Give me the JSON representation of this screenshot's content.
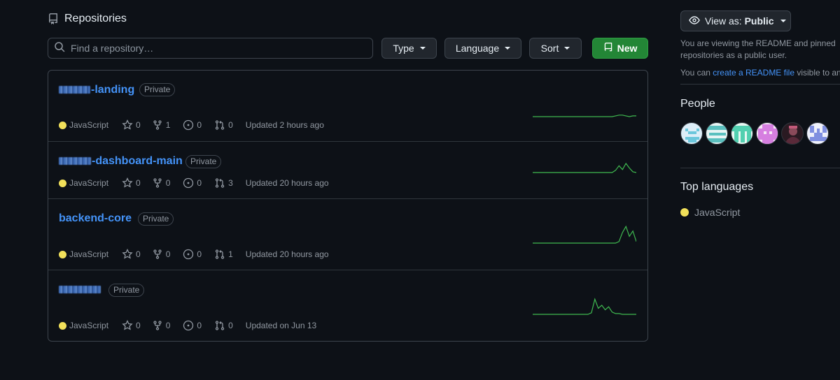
{
  "section": {
    "title": "Repositories"
  },
  "filters": {
    "search_placeholder": "Find a repository…",
    "type_label": "Type",
    "language_label": "Language",
    "sort_label": "Sort",
    "new_label": "New"
  },
  "repos": [
    {
      "name": "-landing",
      "visibility": "Private",
      "language": "JavaScript",
      "stars": "0",
      "forks": "1",
      "issues": "0",
      "prs": "0",
      "updated": "Updated 2 hours ago",
      "activity": [
        0,
        0,
        0,
        0,
        0,
        0,
        0,
        0,
        0,
        0,
        0,
        0,
        0,
        0,
        0,
        0,
        0,
        0,
        0,
        0,
        0,
        0,
        0,
        0,
        1,
        2,
        2,
        1,
        0,
        1,
        1
      ]
    },
    {
      "name": "-dashboard-main",
      "visibility": "Private",
      "language": "JavaScript",
      "stars": "0",
      "forks": "0",
      "issues": "0",
      "prs": "3",
      "updated": "Updated 20 hours ago",
      "activity": [
        0,
        0,
        0,
        0,
        0,
        0,
        0,
        0,
        0,
        0,
        0,
        0,
        0,
        0,
        0,
        0,
        0,
        0,
        0,
        0,
        0,
        0,
        0,
        0,
        3,
        9,
        4,
        12,
        6,
        1,
        0
      ]
    },
    {
      "name": "backend-core",
      "visibility": "Private",
      "language": "JavaScript",
      "stars": "0",
      "forks": "0",
      "issues": "0",
      "prs": "1",
      "updated": "Updated 20 hours ago",
      "activity": [
        0,
        0,
        0,
        0,
        0,
        0,
        0,
        0,
        0,
        0,
        0,
        0,
        0,
        0,
        0,
        0,
        0,
        0,
        0,
        0,
        0,
        0,
        0,
        0,
        0,
        2,
        14,
        22,
        9,
        16,
        2
      ]
    },
    {
      "name": "",
      "visibility": "Private",
      "language": "JavaScript",
      "stars": "0",
      "forks": "0",
      "issues": "0",
      "prs": "0",
      "updated": "Updated on Jun 13",
      "activity": [
        0,
        0,
        0,
        0,
        0,
        0,
        0,
        0,
        0,
        0,
        0,
        0,
        0,
        0,
        0,
        0,
        0,
        2,
        20,
        8,
        12,
        6,
        10,
        3,
        1,
        1,
        0,
        0,
        0,
        0,
        0
      ]
    }
  ],
  "sidebar": {
    "view_as_prefix": "View as:",
    "view_as_value": "Public",
    "note1_line1": "You are viewing the README and pinned",
    "note1_line2": "repositories as a public user.",
    "note2_prefix": "You can",
    "note2_link": "create a README file",
    "note2_suffix": "visible to an",
    "people_title": "People",
    "top_languages_title": "Top languages",
    "top_language": "JavaScript"
  },
  "colors": {
    "accent": "#4493f8",
    "new_button": "#238636",
    "javascript": "#f1e05a",
    "sparkline": "#3fb950"
  }
}
